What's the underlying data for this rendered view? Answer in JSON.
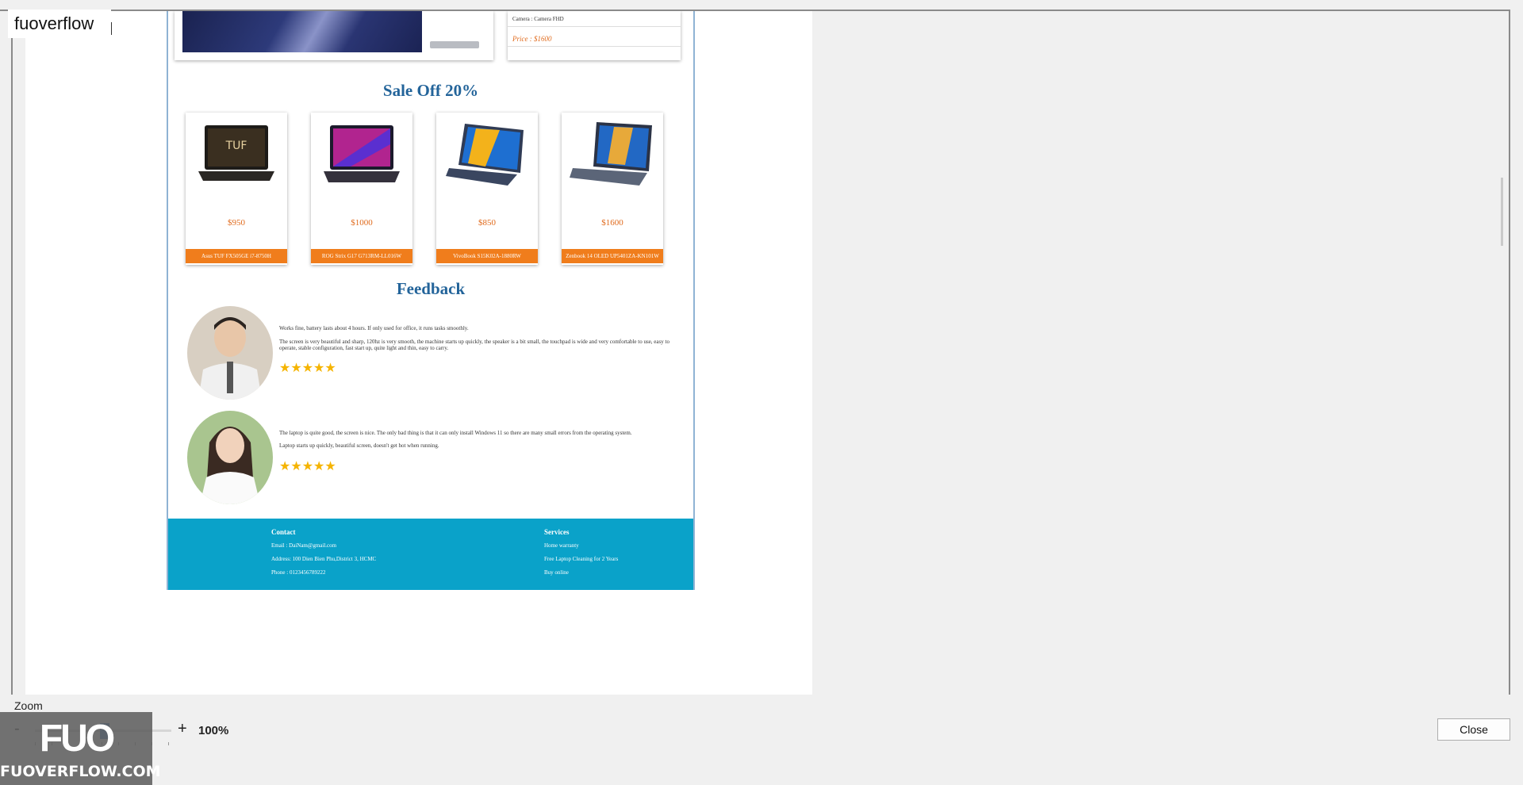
{
  "watermark_tag": "fuoverflow",
  "hero": {
    "spec_line": "Camera : Camera FHD",
    "price": "Price : $1600"
  },
  "sale": {
    "title": "Sale Off 20%",
    "products": [
      {
        "price": "$950",
        "name": "Asus TUF FX505GE i7-8750H",
        "icon": "laptop-gaming-icon"
      },
      {
        "price": "$1000",
        "name": "ROG Strix G17 G713RM-LL016W",
        "icon": "laptop-rog-icon"
      },
      {
        "price": "$850",
        "name": "VivoBook S15K02A-1880RW",
        "icon": "laptop-vivobook-icon"
      },
      {
        "price": "$1600",
        "name": "Zenbook 14 OLED UP5401ZA-KN101W",
        "icon": "laptop-zenbook-icon"
      }
    ]
  },
  "feedback": {
    "title": "Feedback",
    "items": [
      {
        "line1": "Works fine, battery lasts about 4 hours. If only used for office, it runs tasks smoothly.",
        "line2": "The screen is very beautiful and sharp, 120hz is very smooth, the machine starts up quickly, the speaker is a bit small, the touchpad is wide and very comfortable to use, easy to operate, stable configuration, fast start up, quite light and thin, easy to carry.",
        "stars": "★★★★★"
      },
      {
        "line1": "The laptop is quite good, the screen is nice. The only bad thing is that it can only install Windows 11 so there are many small errors from the operating system.",
        "line2": "Laptop starts up quickly, beautiful screen, doesn't get hot when running.",
        "stars": "★★★★★"
      }
    ]
  },
  "footer": {
    "contact_title": "Contact",
    "contact": [
      "Email : DaiNam@gmail.com",
      "Address: 100 Dien Bien Phu,District 3, HCMC",
      "Phone : 0123456789222"
    ],
    "services_title": "Services",
    "services": [
      "Home warranty",
      "Free Laptop Cleaning for 2 Years",
      "Buy online"
    ]
  },
  "zoom": {
    "label": "Zoom",
    "minus": "-",
    "plus": "+",
    "value": "100%",
    "level_percent": 100
  },
  "close_label": "Close",
  "logo": {
    "big": "FUO",
    "small": "FUOVERFLOW.COM"
  },
  "colors": {
    "accent_orange": "#f07d1c",
    "title_blue": "#23649a",
    "footer_cyan": "#0aa2c9"
  }
}
